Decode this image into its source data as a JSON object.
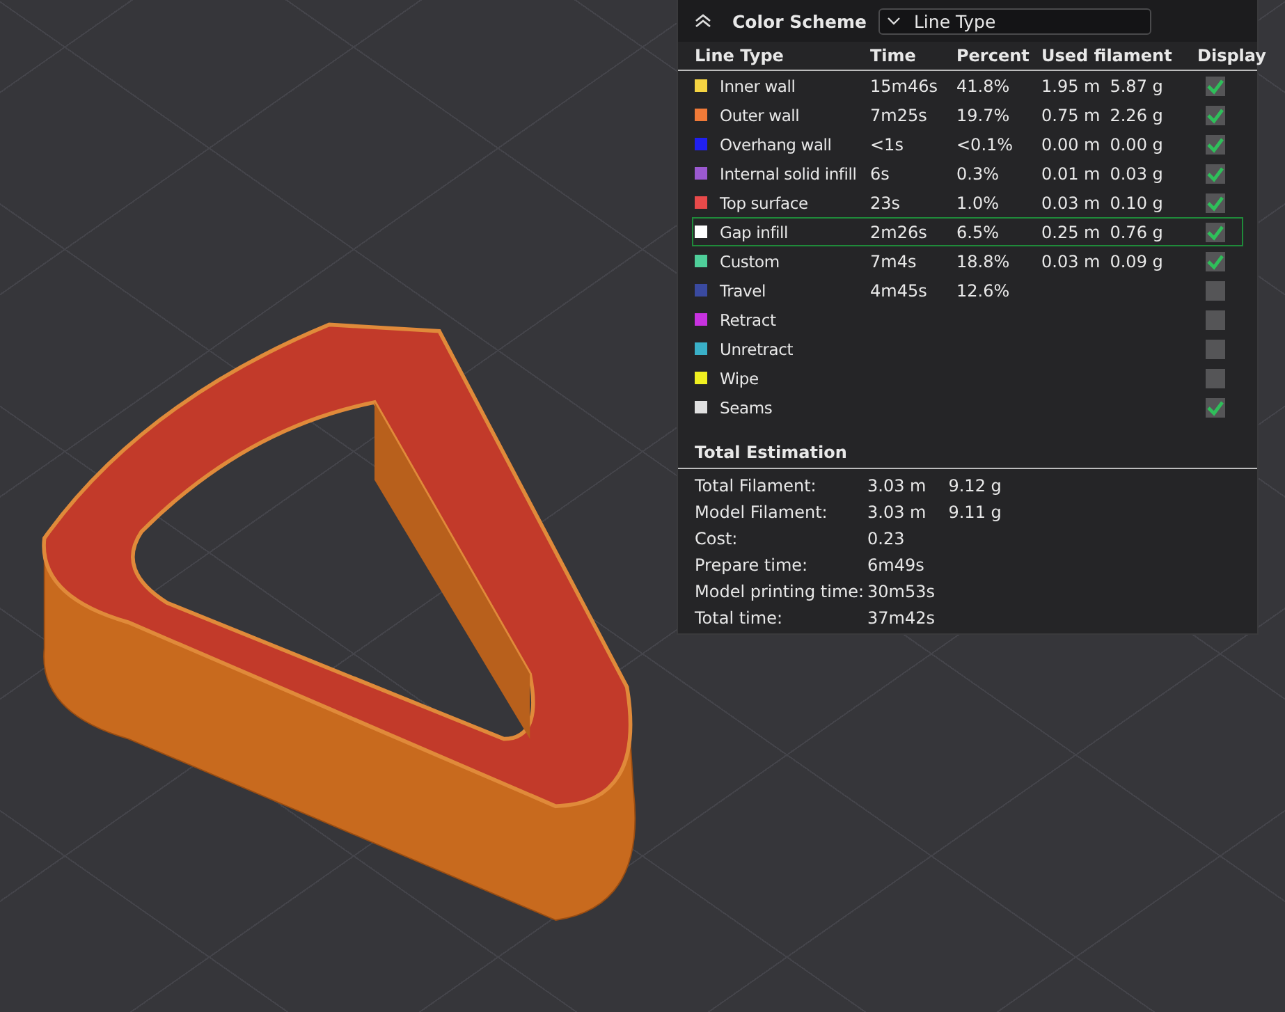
{
  "color_scheme": {
    "title": "Color Scheme",
    "dropdown": "Line Type"
  },
  "table": {
    "columns": [
      "Line Type",
      "Time",
      "Percent",
      "Used filament",
      "Display"
    ],
    "rows": [
      {
        "name": "Inner wall",
        "color": "#f5d442",
        "time": "15m46s",
        "percent": "41.8%",
        "length": "1.95 m",
        "weight": "5.87 g",
        "checked": true,
        "selected": false
      },
      {
        "name": "Outer wall",
        "color": "#f07a38",
        "time": "7m25s",
        "percent": "19.7%",
        "length": "0.75 m",
        "weight": "2.26 g",
        "checked": true,
        "selected": false
      },
      {
        "name": "Overhang wall",
        "color": "#2020f0",
        "time": "<1s",
        "percent": "<0.1%",
        "length": "0.00 m",
        "weight": "0.00 g",
        "checked": true,
        "selected": false
      },
      {
        "name": "Internal solid infill",
        "color": "#9b59d0",
        "time": "6s",
        "percent": "0.3%",
        "length": "0.01 m",
        "weight": "0.03 g",
        "checked": true,
        "selected": false
      },
      {
        "name": "Top surface",
        "color": "#e84a4a",
        "time": "23s",
        "percent": "1.0%",
        "length": "0.03 m",
        "weight": "0.10 g",
        "checked": true,
        "selected": false
      },
      {
        "name": "Gap infill",
        "color": "#ffffff",
        "time": "2m26s",
        "percent": "6.5%",
        "length": "0.25 m",
        "weight": "0.76 g",
        "checked": true,
        "selected": true
      },
      {
        "name": "Custom",
        "color": "#4fcf9a",
        "time": "7m4s",
        "percent": "18.8%",
        "length": "0.03 m",
        "weight": "0.09 g",
        "checked": true,
        "selected": false
      },
      {
        "name": "Travel",
        "color": "#3a4aa0",
        "time": "4m45s",
        "percent": "12.6%",
        "checked": false,
        "selected": false
      },
      {
        "name": "Retract",
        "color": "#c832e0",
        "checked": false,
        "selected": false
      },
      {
        "name": "Unretract",
        "color": "#3ab0c8",
        "checked": false,
        "selected": false
      },
      {
        "name": "Wipe",
        "color": "#f0f020",
        "checked": false,
        "selected": false
      },
      {
        "name": "Seams",
        "color": "#e0e0e0",
        "checked": true,
        "selected": false
      }
    ]
  },
  "total_estimation": {
    "title": "Total Estimation",
    "rows": [
      {
        "label": "Total Filament:",
        "values": [
          "3.03 m",
          "9.12 g"
        ]
      },
      {
        "label": "Model Filament:",
        "values": [
          "3.03 m",
          "9.11 g"
        ]
      },
      {
        "label": "Cost:",
        "values": [
          "0.23"
        ]
      },
      {
        "label": "Prepare time:",
        "values": [
          "6m49s"
        ]
      },
      {
        "label": "Model printing time:",
        "values": [
          "30m53s"
        ]
      },
      {
        "label": "Total time:",
        "values": [
          "37m42s"
        ]
      }
    ]
  }
}
